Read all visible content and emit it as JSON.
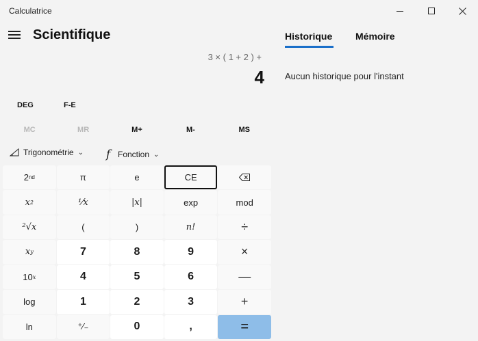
{
  "window": {
    "title": "Calculatrice",
    "minimize_icon": "minimize-icon",
    "maximize_icon": "maximize-icon",
    "close_icon": "close-icon"
  },
  "header": {
    "menu_icon": "hamburger-icon",
    "mode": "Scientifique"
  },
  "display": {
    "expression": "3 × ( 1 + 2 ) +",
    "result": "4"
  },
  "side_panel": {
    "tabs": [
      {
        "label": "Historique",
        "active": true
      },
      {
        "label": "Mémoire",
        "active": false
      }
    ],
    "empty_text": "Aucun historique pour l'instant",
    "accent_color": "#1a6fc9"
  },
  "modes": {
    "angle": "DEG",
    "notation": "F-E"
  },
  "memory": {
    "buttons": [
      {
        "label": "MC",
        "enabled": false
      },
      {
        "label": "MR",
        "enabled": false
      },
      {
        "label": "M+",
        "enabled": true
      },
      {
        "label": "M-",
        "enabled": true
      },
      {
        "label": "MS",
        "enabled": true
      }
    ]
  },
  "functions": {
    "trig_label": "Trigonométrie",
    "func_label": "Fonction",
    "trig_icon": "triangle-ruler-icon",
    "func_icon": "function-f-icon"
  },
  "keys": {
    "second": "2nd",
    "pi": "π",
    "e": "e",
    "ce": "CE",
    "backspace_icon": "backspace-icon",
    "x_squared": "x²",
    "reciprocal": "¹⁄x",
    "abs": "|x|",
    "exp": "exp",
    "mod": "mod",
    "sqrt": "²√x",
    "lparen": "(",
    "rparen": ")",
    "factorial": "n!",
    "divide": "÷",
    "x_pow_y": "xʸ",
    "seven": "7",
    "eight": "8",
    "nine": "9",
    "multiply": "×",
    "ten_pow_x": "10ˣ",
    "four": "4",
    "five": "5",
    "six": "6",
    "minus": "—",
    "log": "log",
    "one": "1",
    "two": "2",
    "three": "3",
    "plus": "+",
    "ln": "ln",
    "negate": "⁺⁄₋",
    "zero": "0",
    "decimal": ",",
    "equals": "="
  },
  "colors": {
    "equals_bg": "#8ebde8",
    "background": "#f3f3f3"
  }
}
